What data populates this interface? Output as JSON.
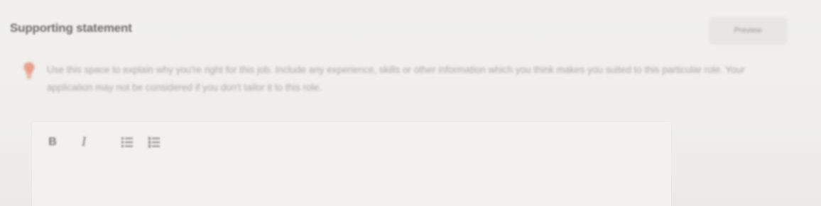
{
  "section": {
    "title": "Supporting statement"
  },
  "preview_button": {
    "label": "Preview"
  },
  "hint": {
    "icon": "lightbulb-icon",
    "icon_color": "#e9a08c",
    "text": "Use this space to explain why you're right for this job. Include any experience, skills or other information which you think makes you suited to this particular role. Your application may not be considered if you don't tailor it to this role."
  },
  "editor": {
    "toolbar": {
      "bold_label": "B",
      "italic_label": "I",
      "icons": [
        "bold-icon",
        "italic-icon",
        "bulleted-list-icon",
        "numbered-list-icon"
      ]
    },
    "value": ""
  }
}
